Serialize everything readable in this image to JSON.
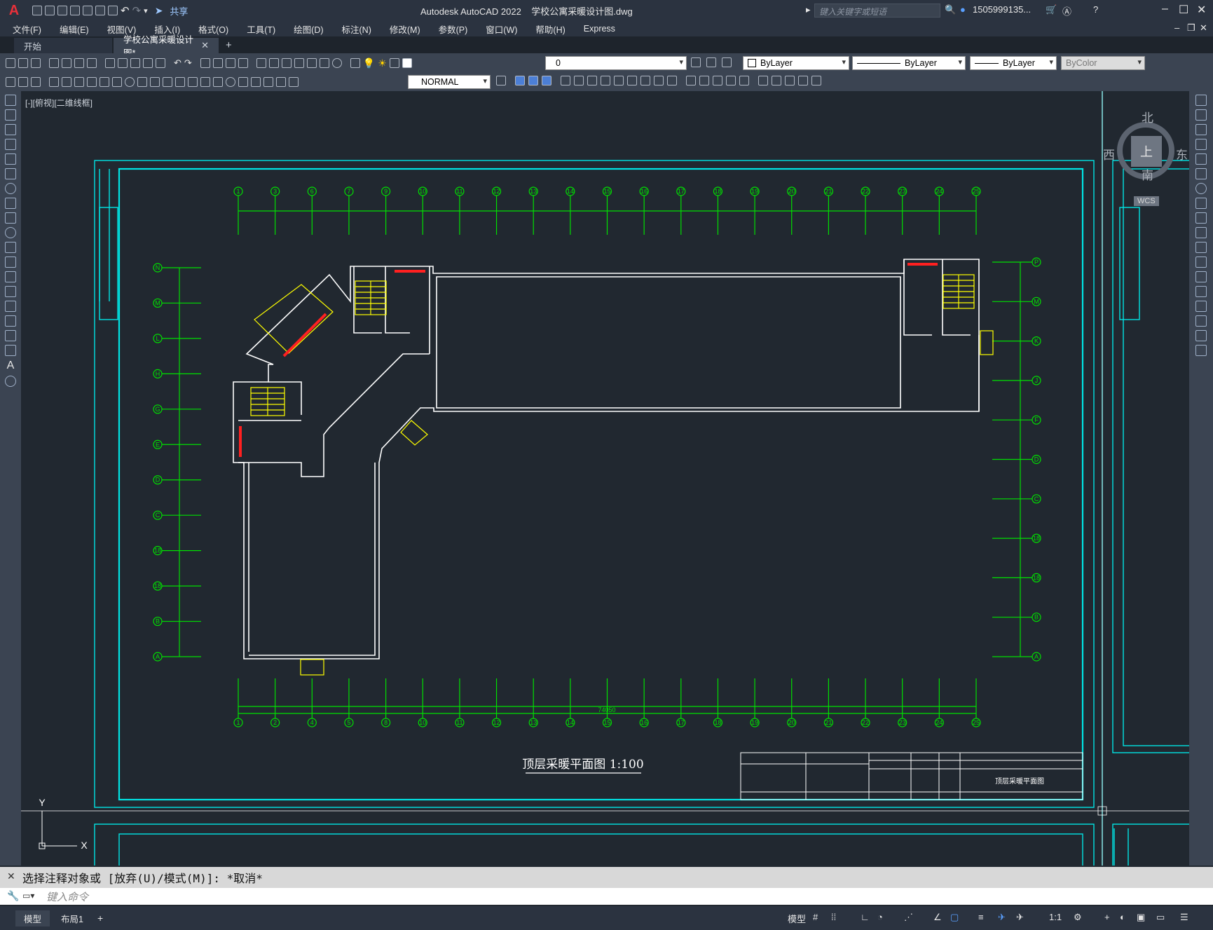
{
  "app": {
    "logo": "A",
    "title": "Autodesk AutoCAD 2022    学校公寓采暖设计图.dwg",
    "search_placeholder": "键入关键字或短语",
    "user": "1505999135...",
    "share_label": "共享"
  },
  "menu": [
    "文件(F)",
    "编辑(E)",
    "视图(V)",
    "插入(I)",
    "格式(O)",
    "工具(T)",
    "绘图(D)",
    "标注(N)",
    "修改(M)",
    "参数(P)",
    "窗口(W)",
    "帮助(H)",
    "Express"
  ],
  "tabs": [
    {
      "label": "开始"
    },
    {
      "label": "学校公寓采暖设计图*"
    }
  ],
  "toolbar": {
    "layer_value": "0",
    "color_value": "ByLayer",
    "linetype_value": "ByLayer",
    "lineweight_value": "ByLayer",
    "plotstyle_value": "ByColor",
    "dimstyle_value": "NORMAL"
  },
  "viewport": {
    "label": "[-][俯视][二维线框]",
    "viewcube": {
      "north": "北",
      "south": "南",
      "east": "东",
      "west": "西",
      "top": "上",
      "wcs": "WCS"
    },
    "ucs_x": "X",
    "ucs_y": "Y"
  },
  "drawing": {
    "title": "顶层采暖平面图 1:100",
    "total_dim": "74050",
    "top_axes": [
      "1",
      "3",
      "6",
      "7",
      "9",
      "10",
      "11",
      "12",
      "13",
      "14",
      "15",
      "16",
      "17",
      "18",
      "19",
      "20",
      "21",
      "22",
      "23",
      "24",
      "25"
    ],
    "bottom_axes": [
      "1",
      "2",
      "4",
      "5",
      "8",
      "10",
      "11",
      "12",
      "13",
      "14",
      "15",
      "16",
      "17",
      "18",
      "19",
      "20",
      "21",
      "22",
      "23",
      "24",
      "25"
    ],
    "left_axes": [
      "N",
      "M",
      "L",
      "H",
      "G",
      "E",
      "D",
      "C",
      "18",
      "18",
      "B",
      "A"
    ],
    "right_axes": [
      "P",
      "M",
      "K",
      "J",
      "F",
      "D",
      "C",
      "18",
      "18",
      "B",
      "A"
    ],
    "titleblock_drawing_name": "顶层采暖平面图"
  },
  "command": {
    "history": "选择注释对象或 [放弃(U)/模式(M)]: *取消*",
    "placeholder": "键入命令"
  },
  "status": {
    "tabs": [
      "模型",
      "布局1"
    ],
    "model_label": "模型",
    "scale": "1:1"
  },
  "colors": {
    "bg": "#212830",
    "cyan": "#00e5e5",
    "green": "#00e000",
    "yellow": "#ffff00",
    "red": "#ff2020",
    "white": "#ffffff"
  }
}
